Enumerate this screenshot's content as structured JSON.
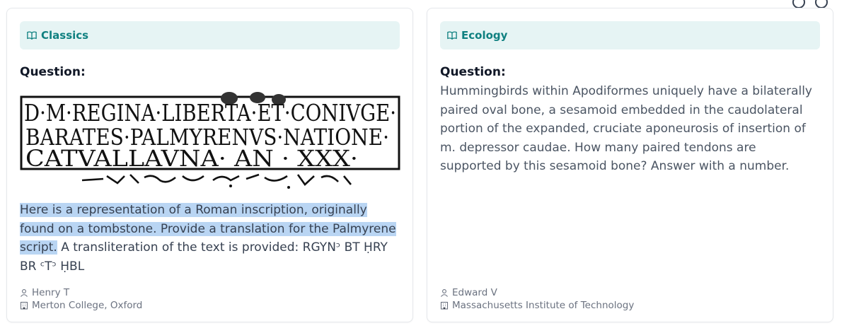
{
  "cards": [
    {
      "subject": "Classics",
      "question_label": "Question:",
      "highlighted_text": "Here is a representation of a Roman inscription, originally found on a tombstone. Provide a translation for the Palmyrene script.",
      "body_text": "A transliteration of the text is provided: RGYNᵓ BT ḤRY BR ᶜTᵓ ḤBL",
      "inscription": {
        "line1": "D·M·REGINA·LIBERTA·ET·CONIVGE·",
        "line2": "BARATES·PALMYRENVS·NATIONE·",
        "line3": "CATVALLAVNA· AN · XXX·"
      },
      "author": "Henry T",
      "institution": "Merton College, Oxford"
    },
    {
      "subject": "Ecology",
      "question_label": "Question:",
      "body_text": "Hummingbirds within Apodiformes uniquely have a bilaterally paired oval bone, a sesamoid embedded in the caudolateral portion of the expanded, cruciate aponeurosis of insertion of m. depressor caudae. How many paired tendons are supported by this sesamoid bone? Answer with a number.",
      "author": "Edward V",
      "institution": "Massachusetts Institute of Technology"
    }
  ]
}
